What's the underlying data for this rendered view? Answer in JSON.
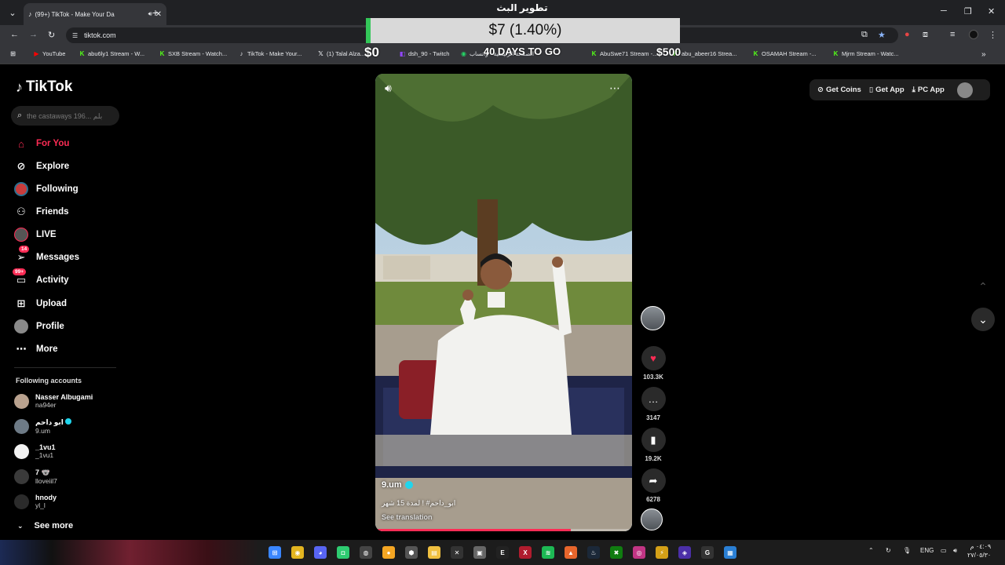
{
  "browser": {
    "tab_title": "(99+) TikTok - Make Your Da",
    "url": "tiktok.com",
    "bookmarks": [
      {
        "label": "YouTube",
        "icon": "youtube-icon",
        "color": "#ff0000"
      },
      {
        "label": "abu6ly1 Stream - W...",
        "icon": "kick-icon",
        "color": "#53fc18"
      },
      {
        "label": "SXB Stream - Watch...",
        "icon": "kick-icon",
        "color": "#53fc18"
      },
      {
        "label": "TikTok - Make Your...",
        "icon": "tiktok-icon",
        "color": "#ffffff"
      },
      {
        "label": "(1) Talal Alza...",
        "icon": "x-icon",
        "color": "#ffffff"
      },
      {
        "label": "dsh_90 - Twitch",
        "icon": "twitch-icon",
        "color": "#9146ff"
      },
      {
        "label": "الصفحة الرئيسية - واتساب",
        "icon": "whatsapp-icon",
        "color": "#25d366"
      },
      {
        "label": "AbuSwe71 Stream -...",
        "icon": "kick-icon",
        "color": "#53fc18"
      },
      {
        "label": "abu_abeer16 Strea...",
        "icon": "kick-icon",
        "color": "#53fc18"
      },
      {
        "label": "OSAMAH Stream -...",
        "icon": "kick-icon",
        "color": "#53fc18"
      },
      {
        "label": "Mjrm Stream - Watc...",
        "icon": "kick-icon",
        "color": "#53fc18"
      }
    ]
  },
  "overlay": {
    "title": "تطوير البث",
    "amount": "$7 (1.40%)",
    "progress_percent": 1.4,
    "left_amount": "$0",
    "right_amount": "$500",
    "days": "40 DAYS TO GO"
  },
  "tiktok": {
    "logo": "TikTok",
    "search_placeholder": "the castaways 196... بلم",
    "nav": [
      {
        "label": "For You",
        "icon": "home-icon",
        "active": true
      },
      {
        "label": "Explore",
        "icon": "compass-icon"
      },
      {
        "label": "Following",
        "icon": "following-icon"
      },
      {
        "label": "Friends",
        "icon": "friends-icon"
      },
      {
        "label": "LIVE",
        "icon": "live-icon"
      },
      {
        "label": "Messages",
        "icon": "messages-icon",
        "badge": "14"
      },
      {
        "label": "Activity",
        "icon": "activity-icon",
        "badge": "99+"
      },
      {
        "label": "Upload",
        "icon": "upload-icon"
      },
      {
        "label": "Profile",
        "icon": "profile-icon"
      },
      {
        "label": "More",
        "icon": "more-icon"
      }
    ],
    "following_title": "Following accounts",
    "accounts": [
      {
        "name": "Nasser Albugami",
        "handle": "na94er"
      },
      {
        "name": "ابو داحم",
        "handle": "9.um",
        "verified": true
      },
      {
        "name": "_1vu1",
        "handle": "_1vu1"
      },
      {
        "name": "7 🐨",
        "handle": "lloveiil7"
      },
      {
        "name": "hnody",
        "handle": "yl_l"
      }
    ],
    "see_more": "See more",
    "top_buttons": {
      "coins": "Get Coins",
      "app": "Get App",
      "pc": "PC App"
    },
    "video": {
      "author": "9.um",
      "caption": "ابو_داحم# ! لمدة 15 شهر",
      "see_translation": "See translation",
      "progress": 0.76
    },
    "actions": {
      "likes": "103.3K",
      "comments": "3147",
      "saves": "19.2K",
      "shares": "6278"
    }
  },
  "taskbar": {
    "lang": "ENG",
    "time": "٠٤:٠٩ م",
    "date": "٢٧/٠٥/٣٠"
  }
}
